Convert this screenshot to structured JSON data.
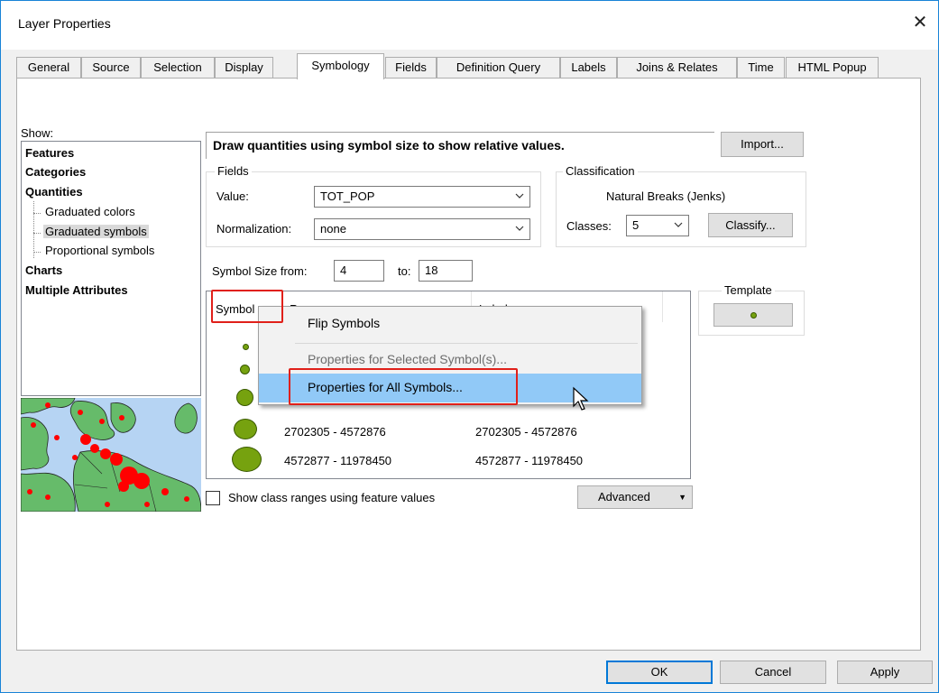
{
  "window": {
    "title": "Layer Properties",
    "close_glyph": "✕"
  },
  "tabs": [
    {
      "label": "General"
    },
    {
      "label": "Source"
    },
    {
      "label": "Selection"
    },
    {
      "label": "Display"
    },
    {
      "label": "Symbology"
    },
    {
      "label": "Fields"
    },
    {
      "label": "Definition Query"
    },
    {
      "label": "Labels"
    },
    {
      "label": "Joins & Relates"
    },
    {
      "label": "Time"
    },
    {
      "label": "HTML Popup"
    }
  ],
  "active_tab": "Symbology",
  "show": {
    "label": "Show:",
    "items": [
      {
        "label": "Features"
      },
      {
        "label": "Categories"
      },
      {
        "label": "Quantities"
      },
      {
        "label": "Graduated colors"
      },
      {
        "label": "Graduated symbols"
      },
      {
        "label": "Proportional symbols"
      },
      {
        "label": "Charts"
      },
      {
        "label": "Multiple Attributes"
      }
    ],
    "selected": "Graduated symbols"
  },
  "description": "Draw quantities using symbol size to show relative values.",
  "import_button": "Import...",
  "fields_group": {
    "title": "Fields",
    "value_label": "Value:",
    "value": "TOT_POP",
    "normalization_label": "Normalization:",
    "normalization": "none"
  },
  "classification_group": {
    "title": "Classification",
    "method": "Natural Breaks (Jenks)",
    "classes_label": "Classes:",
    "classes": "5",
    "classify_button": "Classify..."
  },
  "symbol_size": {
    "from_label": "Symbol Size from:",
    "from": "4",
    "to_label": "to:",
    "to": "18"
  },
  "table": {
    "headers": {
      "symbol": "Symbol",
      "range": "Range",
      "label": "Label"
    },
    "rows": [
      {
        "range": "",
        "label": ""
      },
      {
        "range": "",
        "label": ""
      },
      {
        "range": "",
        "label": ""
      },
      {
        "range": "2702305 - 4572876",
        "label": "2702305 - 4572876"
      },
      {
        "range": "4572877 - 11978450",
        "label": "4572877 - 11978450"
      }
    ]
  },
  "template": {
    "title": "Template"
  },
  "show_class_ranges": {
    "label": "Show class ranges using feature values",
    "checked": false
  },
  "advanced_button": "Advanced",
  "context_menu": {
    "items": [
      {
        "label": "Flip Symbols",
        "enabled": true
      },
      {
        "label": "Properties for Selected Symbol(s)...",
        "enabled": false
      },
      {
        "label": "Properties for All Symbols...",
        "enabled": true,
        "highlighted": true
      }
    ]
  },
  "footer": {
    "ok": "OK",
    "cancel": "Cancel",
    "apply": "Apply"
  },
  "colors": {
    "symbol_fill": "#76a20f",
    "highlight": "#91c9f7",
    "annotation": "#e0201a",
    "accent": "#0078d7"
  }
}
